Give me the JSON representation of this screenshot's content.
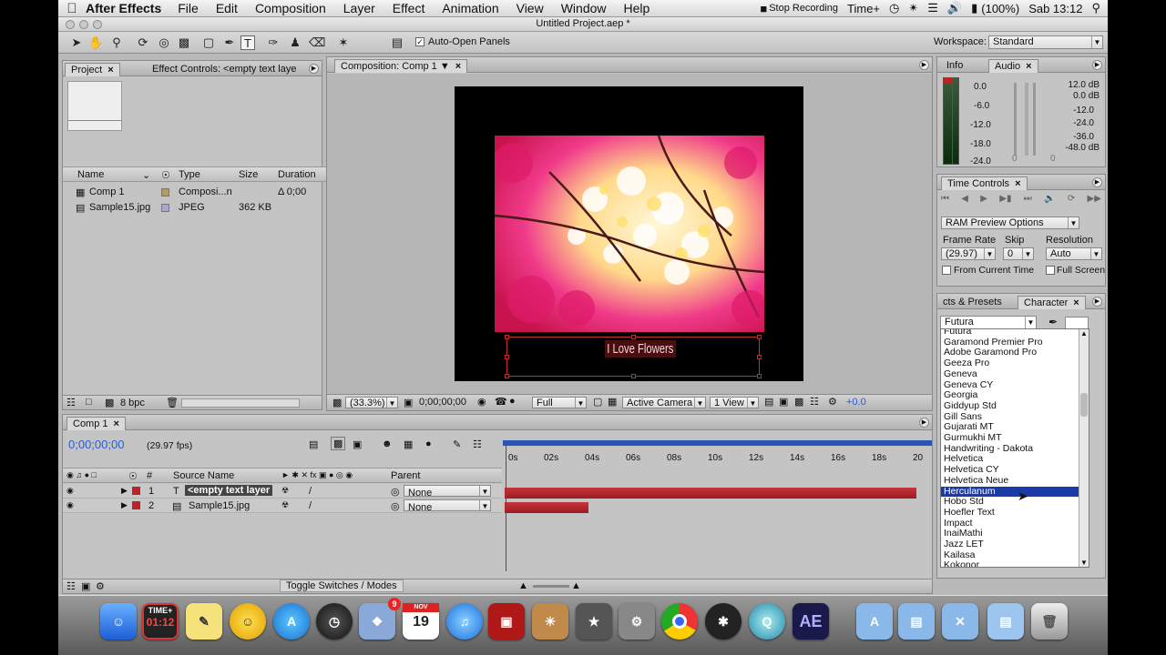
{
  "menubar": {
    "app_name": "After Effects",
    "items": [
      "File",
      "Edit",
      "Composition",
      "Layer",
      "Effect",
      "Animation",
      "View",
      "Window",
      "Help"
    ],
    "status": {
      "stop_recording": "Stop Recording",
      "timeplus": "Time+",
      "battery": "(100%)",
      "clock": "Sab 13:12"
    }
  },
  "window": {
    "title": "Untitled Project.aep *"
  },
  "toolbar": {
    "auto_open_label": "Auto-Open Panels",
    "workspace_label": "Workspace:",
    "workspace_value": "Standard"
  },
  "project_panel": {
    "tab_project": "Project",
    "tab_effect_controls": "Effect Controls: <empty text laye",
    "columns": [
      "Name",
      "Type",
      "Size",
      "Duration"
    ],
    "items": [
      {
        "name": "Comp 1",
        "type": "Composi...n",
        "size": "",
        "duration": "Δ 0;00",
        "label_color": "#b39a6a"
      },
      {
        "name": "Sample15.jpg",
        "type": "JPEG",
        "size": "362 KB",
        "duration": "",
        "label_color": "#a8a8d0"
      }
    ],
    "bpc": "8 bpc"
  },
  "comp_panel": {
    "tab": "Composition: Comp 1",
    "text_layer": "I Love Flowers",
    "zoom": "(33.3%)",
    "timecode": "0;00;00;00",
    "resolution": "Full",
    "camera": "Active Camera",
    "views": "1 View",
    "exposure": "+0.0"
  },
  "info_audio": {
    "tab_info": "Info",
    "tab_audio": "Audio",
    "left_scale": [
      "0.0",
      "-6.0",
      "-12.0",
      "-18.0",
      "-24.0"
    ],
    "right_scale": [
      "12.0 dB",
      "0.0 dB",
      "-12.0",
      "-24.0",
      "-36.0",
      "-48.0 dB"
    ],
    "slider_values": [
      "0",
      "0"
    ]
  },
  "time_controls": {
    "tab": "Time Controls",
    "preview_options": "RAM Preview Options",
    "frame_rate_label": "Frame Rate",
    "skip_label": "Skip",
    "resolution_label": "Resolution",
    "frame_rate_value": "(29.97)",
    "skip_value": "0",
    "resolution_value": "Auto",
    "from_current_time": "From Current Time",
    "full_screen": "Full Screen"
  },
  "character": {
    "tab_effects": "cts & Presets",
    "tab_character": "Character",
    "font_value": "Futura",
    "fonts": [
      "Futura",
      "Garamond Premier Pro",
      "Adobe Garamond Pro",
      "Geeza Pro",
      "Geneva",
      "Geneva CY",
      "Georgia",
      "Giddyup Std",
      "Gill Sans",
      "Gujarati MT",
      "Gurmukhi MT",
      "Handwriting - Dakota",
      "Helvetica",
      "Helvetica CY",
      "Helvetica Neue",
      "Herculanum",
      "Hobo Std",
      "Hoefler Text",
      "Impact",
      "InaiMathi",
      "Jazz LET",
      "Kailasa",
      "Kokonor"
    ],
    "highlighted": "Herculanum"
  },
  "timeline": {
    "tab": "Comp 1",
    "timecode": "0;00;00;00",
    "fps": "(29.97 fps)",
    "col_source": "Source Name",
    "col_num": "#",
    "col_parent": "Parent",
    "layers": [
      {
        "num": "1",
        "name": "<empty text layer",
        "parent": "None",
        "type_icon": "T"
      },
      {
        "num": "2",
        "name": "Sample15.jpg",
        "parent": "None",
        "type_icon": "img"
      }
    ],
    "ruler": [
      "0s",
      "02s",
      "04s",
      "06s",
      "08s",
      "10s",
      "12s",
      "14s",
      "16s",
      "18s",
      "20"
    ],
    "toggle_label": "Toggle Switches / Modes"
  },
  "dock": {
    "items": [
      "Finder",
      "Time+",
      "Stickies",
      "Messenger",
      "App Store",
      "Clock",
      "Preview",
      "Calendar",
      "iTunes",
      "Photo Booth",
      "iPhoto",
      "iMovie",
      "System Preferences",
      "Chrome",
      "BlackBerry",
      "QuickTime",
      "After Effects",
      "Applications",
      "Documents",
      "Utilities",
      "Folder",
      "Trash"
    ],
    "calendar_day": "19",
    "calendar_month": "NOV",
    "mail_badge": "9",
    "ae_label": "AE",
    "timeplus_label": "TIME+",
    "timeplus_time": "01:12"
  }
}
